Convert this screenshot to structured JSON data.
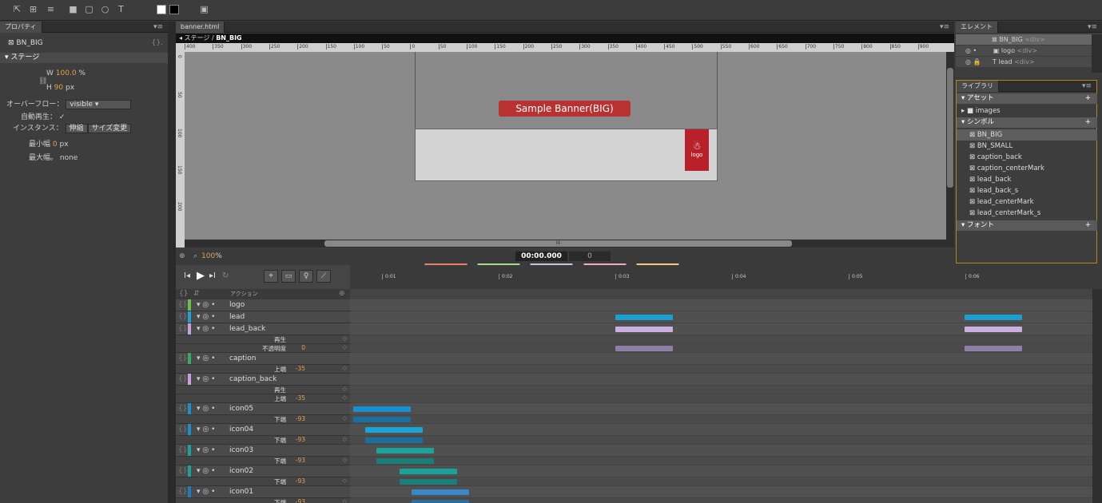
{
  "toolbar": {
    "icons": [
      "pointer-tool",
      "grid-tool",
      "rect-tool",
      "square-tool",
      "rounded-rect-tool",
      "ellipse-tool",
      "text-tool",
      "fill-white",
      "fill-black",
      "stage-tool"
    ]
  },
  "properties": {
    "tab": "プロパティ",
    "element": "BN_BIG",
    "brace": "{}.",
    "section": "ステージ",
    "w_label": "W",
    "w_value": "100.0",
    "w_unit": "%",
    "h_label": "H",
    "h_value": "90",
    "h_unit": "px",
    "overflow_label": "オーバーフロー：",
    "overflow_value": "visible",
    "autoplay_label": "自動再生：",
    "autoplay_check": "✓",
    "instance_label": "インスタンス：",
    "instance_btn1": "伸縮",
    "instance_btn2": "サイズ変更",
    "min_label": "最小幅",
    "min_value": "0",
    "min_unit": "px",
    "max_label": "最大幅。",
    "max_value": "none"
  },
  "stage": {
    "tab": "banner.html",
    "breadcrumb": "◂ ステージ / ",
    "breadcrumb_current": "BN_BIG",
    "ruler": [
      "400",
      "350",
      "300",
      "250",
      "200",
      "150",
      "100",
      "50",
      "0",
      "50",
      "100",
      "150",
      "200",
      "250",
      "300",
      "350",
      "400",
      "450",
      "500",
      "550",
      "600",
      "650",
      "700",
      "750",
      "800",
      "850",
      "900"
    ],
    "vruler": [
      "0",
      "50",
      "100",
      "150",
      "200"
    ],
    "banner_title": "Sample Banner(BIG)",
    "logo_label": "logo",
    "icons": [
      "circle",
      "square",
      "triangle",
      "cross",
      "heart"
    ],
    "zoom": "100",
    "zoom_unit": "%",
    "timecode": "00:00.000",
    "time_input": "0",
    "scroll_dots": "III"
  },
  "elements": {
    "tab": "エレメント",
    "items": [
      {
        "name": "BN_BIG",
        "tag": "<div>"
      },
      {
        "name": "logo",
        "tag": "<div>"
      },
      {
        "name": "lead",
        "tag": "<div>"
      }
    ]
  },
  "library": {
    "tab": "ライブラリ",
    "assets": "アセット",
    "images": "images",
    "symbols": "シンボル",
    "fonts": "フォント",
    "plus": "+",
    "symbol_items": [
      "BN_BIG",
      "BN_SMALL",
      "caption_back",
      "caption_centerMark",
      "lead_back",
      "lead_back_s",
      "lead_centerMark",
      "lead_centerMark_s"
    ]
  },
  "timeline": {
    "actions_label": "アクション",
    "ticks": [
      "0:01",
      "0:02",
      "0:03",
      "0:04",
      "0:05",
      "0:06"
    ],
    "rows": [
      {
        "name": "logo",
        "type": "element",
        "color": "#6cbf4a"
      },
      {
        "name": "lead",
        "type": "element",
        "color": "#1aa4d8"
      },
      {
        "name": "lead_back",
        "type": "element",
        "color": "#c9a0dc"
      },
      {
        "name": "再生",
        "type": "prop",
        "value": ""
      },
      {
        "name": "不透明度",
        "type": "prop",
        "value": "0"
      },
      {
        "name": "caption",
        "type": "element",
        "color": "#3aa86a"
      },
      {
        "name": "上端",
        "type": "prop",
        "value": "-35"
      },
      {
        "name": "caption_back",
        "type": "element",
        "color": "#c9a0dc"
      },
      {
        "name": "再生",
        "type": "prop",
        "value": ""
      },
      {
        "name": "上端",
        "type": "prop",
        "value": "-35"
      },
      {
        "name": "icon05",
        "type": "element",
        "color": "#1a8fcf"
      },
      {
        "name": "下端",
        "type": "prop",
        "value": "-93"
      },
      {
        "name": "icon04",
        "type": "element",
        "color": "#1a8fcf"
      },
      {
        "name": "下端",
        "type": "prop",
        "value": "-93"
      },
      {
        "name": "icon03",
        "type": "element",
        "color": "#1aa39a"
      },
      {
        "name": "下端",
        "type": "prop",
        "value": "-93"
      },
      {
        "name": "icon02",
        "type": "element",
        "color": "#1aa39a"
      },
      {
        "name": "下端",
        "type": "prop",
        "value": "-93"
      },
      {
        "name": "icon01",
        "type": "element",
        "color": "#1a7fc0"
      },
      {
        "name": "下端",
        "type": "prop",
        "value": "-93"
      }
    ]
  }
}
